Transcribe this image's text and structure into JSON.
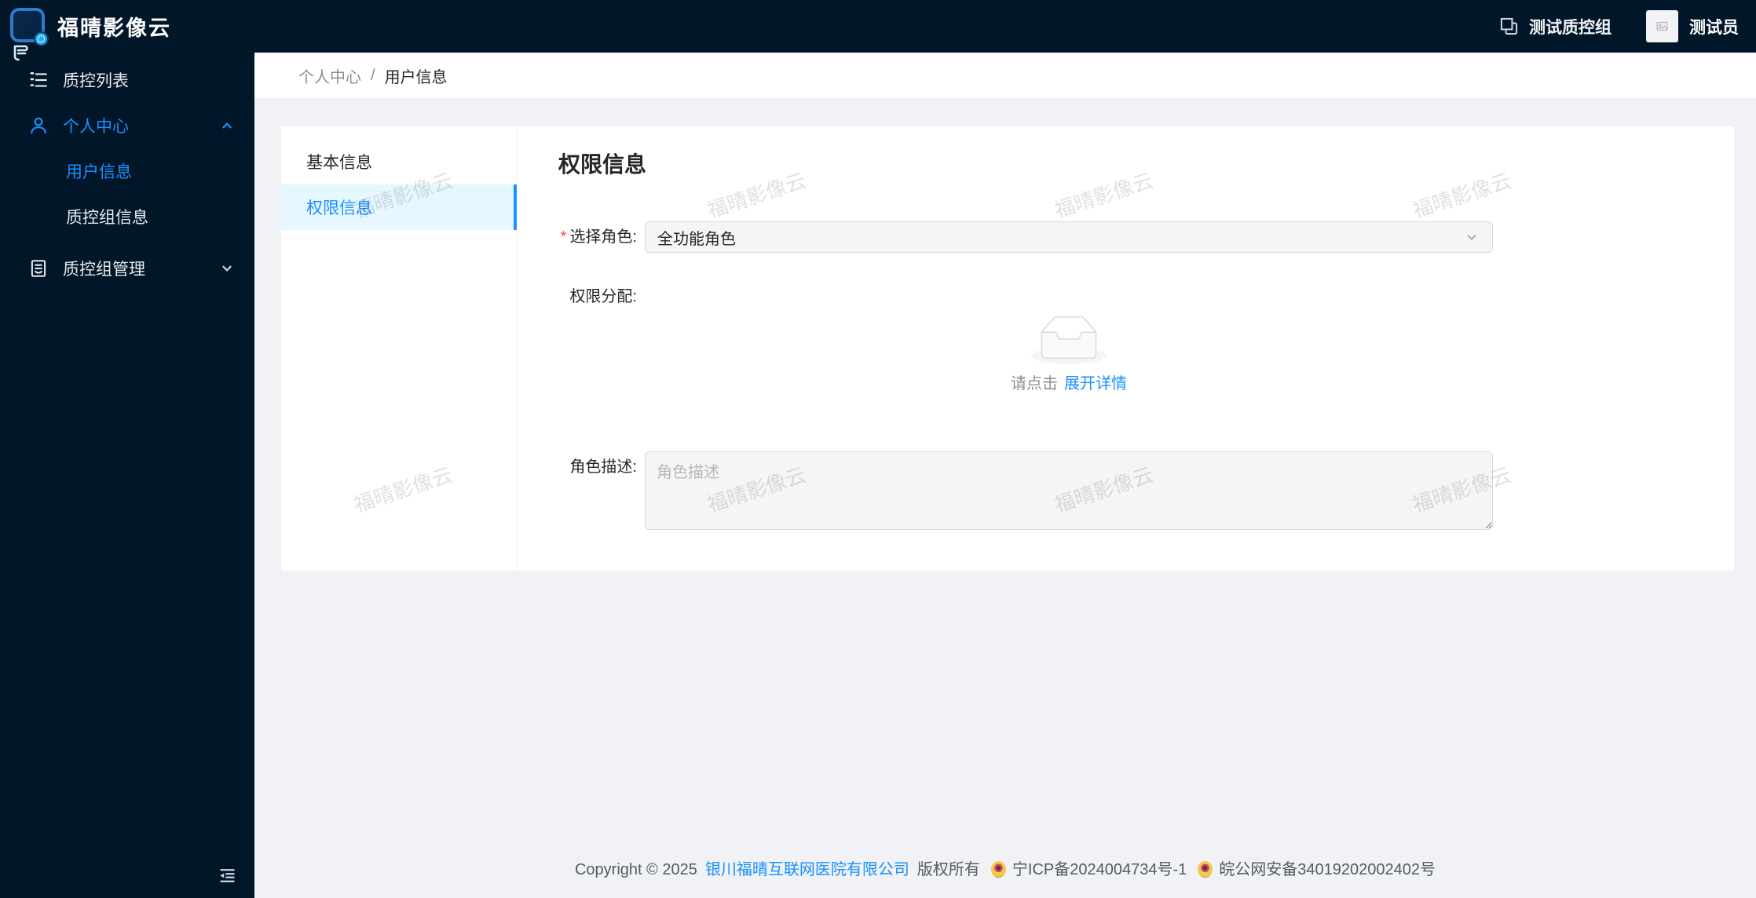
{
  "app": {
    "title": "福晴影像云"
  },
  "header": {
    "group_switcher": "测试质控组",
    "username": "测试员"
  },
  "sidebar": {
    "items": [
      {
        "label": "质控列表",
        "icon": "ordered-list-icon"
      },
      {
        "label": "个人中心",
        "icon": "user-icon",
        "expanded": true,
        "children": [
          {
            "label": "用户信息",
            "active": true
          },
          {
            "label": "质控组信息",
            "active": false
          }
        ]
      },
      {
        "label": "质控组管理",
        "icon": "board-icon",
        "expanded": false
      }
    ]
  },
  "breadcrumb": {
    "parent": "个人中心",
    "separator": "/",
    "current": "用户信息"
  },
  "tabs": [
    {
      "label": "基本信息",
      "active": false
    },
    {
      "label": "权限信息",
      "active": true
    }
  ],
  "panel": {
    "title": "权限信息",
    "role_select": {
      "required_mark": "*",
      "label": "选择角色:",
      "value": "全功能角色"
    },
    "permission": {
      "label": "权限分配:",
      "hint": "请点击",
      "expand_link": "展开详情"
    },
    "description": {
      "label": "角色描述:",
      "placeholder": "角色描述",
      "value": ""
    }
  },
  "watermark": {
    "text": "福晴影像云"
  },
  "footer": {
    "copyright": "Copyright © 2025",
    "company": "银川福晴互联网医院有限公司",
    "rights": "版权所有",
    "icp": "宁ICP备2024004734号-1",
    "police": "皖公网安备34019202002402号"
  },
  "colors": {
    "accent": "#1890ff",
    "sider_bg": "#011629",
    "page_bg": "#f0f2f5",
    "tab_active_bg": "#e6f7ff",
    "input_bg": "#f5f5f5",
    "input_border": "#d9d9d9",
    "required": "#ff4d4f"
  }
}
